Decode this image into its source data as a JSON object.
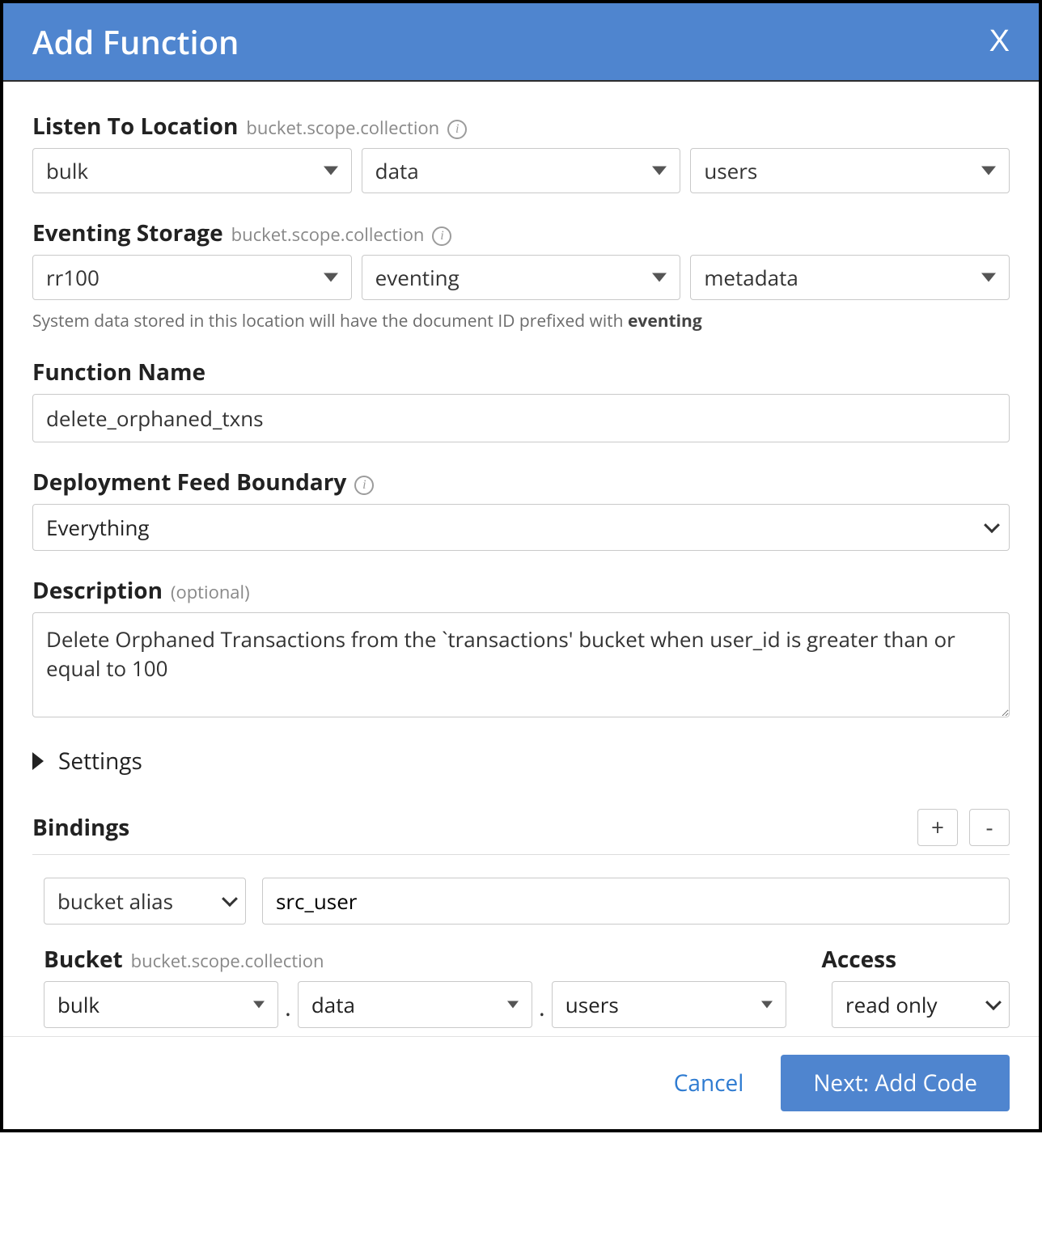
{
  "header": {
    "title": "Add Function",
    "close": "X"
  },
  "listen": {
    "label": "Listen To Location",
    "sublabel": "bucket.scope.collection",
    "bucket": "bulk",
    "scope": "data",
    "collection": "users"
  },
  "storage": {
    "label": "Eventing Storage",
    "sublabel": "bucket.scope.collection",
    "bucket": "rr100",
    "scope": "eventing",
    "collection": "metadata",
    "hint_prefix": "System data stored in this location will have the document ID prefixed with ",
    "hint_bold": "eventing"
  },
  "function_name": {
    "label": "Function Name",
    "value": "delete_orphaned_txns"
  },
  "feed_boundary": {
    "label": "Deployment Feed Boundary",
    "value": "Everything"
  },
  "description": {
    "label": "Description",
    "optional": "(optional)",
    "value": "Delete Orphaned Transactions from the `transactions' bucket when user_id is greater than or equal to 100"
  },
  "settings": {
    "label": "Settings"
  },
  "bindings": {
    "label": "Bindings",
    "plus": "+",
    "minus": "-",
    "items": [
      {
        "type": "bucket alias",
        "alias": "src_user",
        "bucket_label": "Bucket",
        "bucket_sub": "bucket.scope.collection",
        "bucket": "bulk",
        "scope": "data",
        "collection": "users",
        "access_label": "Access",
        "access": "read only"
      }
    ]
  },
  "footer": {
    "cancel": "Cancel",
    "next": "Next: Add Code"
  }
}
